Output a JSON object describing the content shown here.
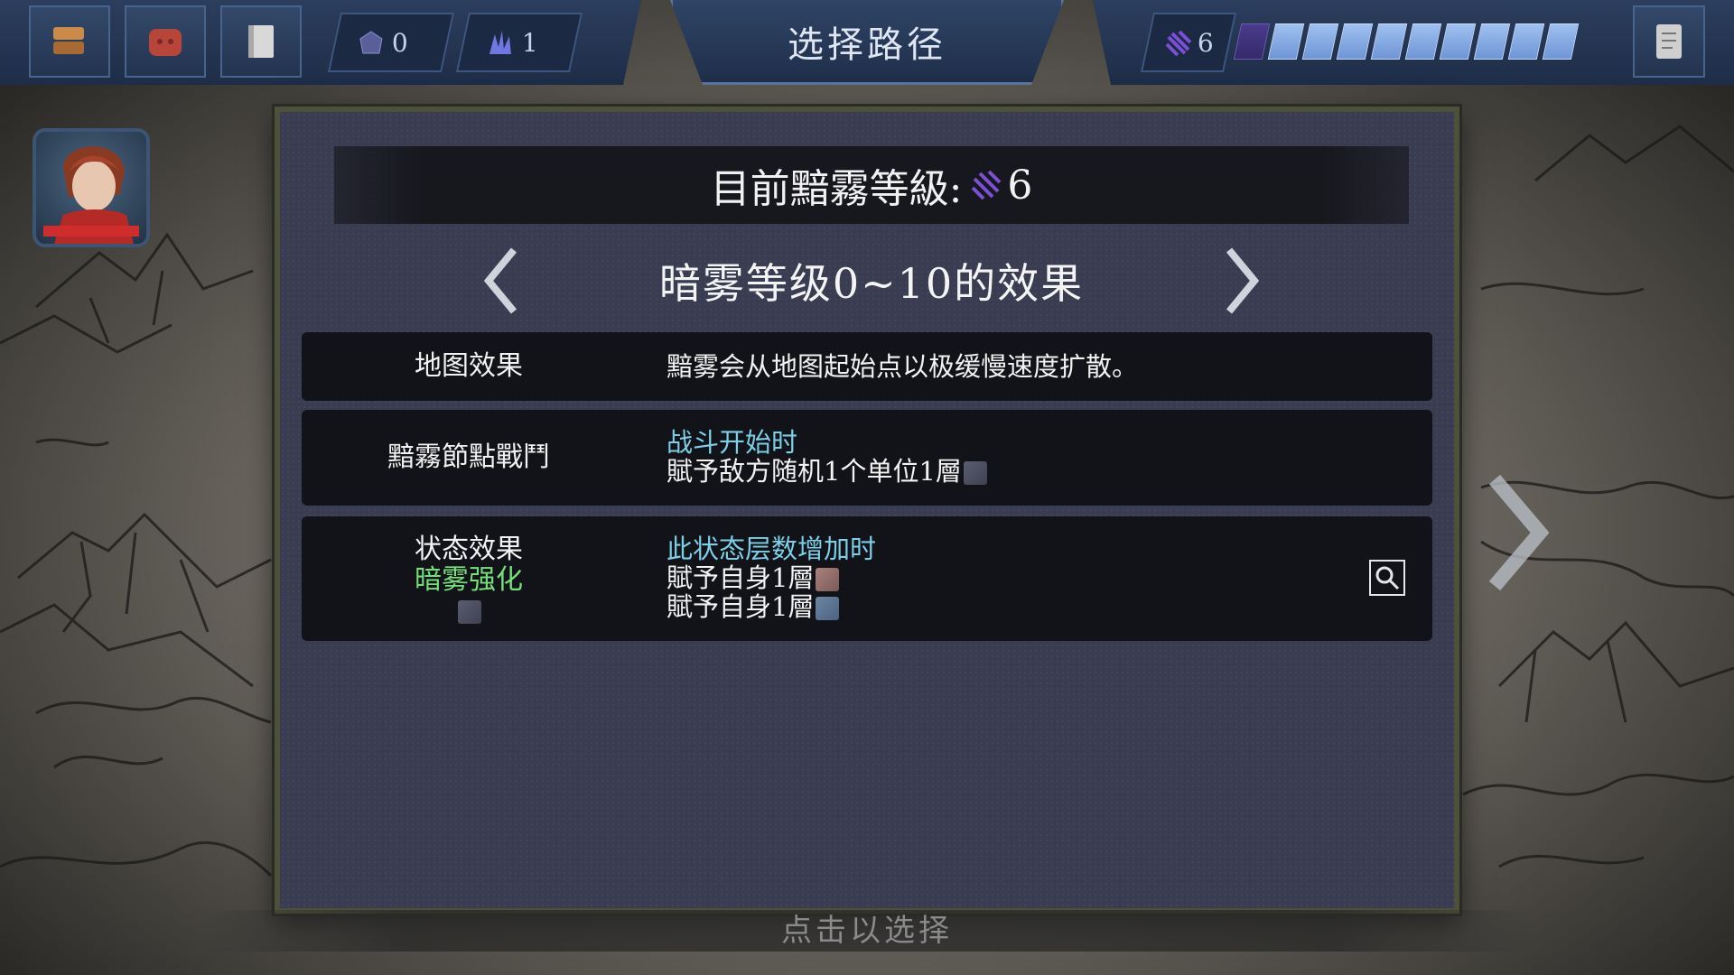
{
  "topbar": {
    "title": "选择路径",
    "resource_1_value": "0",
    "resource_2_value": "1",
    "fog_level_value": "6",
    "fog_gauge": {
      "filled": 9,
      "dark": 1
    }
  },
  "panel": {
    "header_label": "目前黯霧等級:",
    "header_level": "6",
    "range_title": "暗雾等级0~10的效果",
    "rows": [
      {
        "label": "地图效果",
        "desc": "黯雾会从地图起始点以极缓慢速度扩散。"
      },
      {
        "label": "黯霧節點戰鬥",
        "trigger": "战斗开始时",
        "desc": "賦予敌方随机1个单位1層"
      },
      {
        "label": "状态效果",
        "label_highlight": "暗雾强化",
        "trigger": "此状态层数增加时",
        "desc_1": "賦予自身1層",
        "desc_2": "賦予自身1層"
      }
    ]
  },
  "bottom_hint": "点击以选择",
  "colors": {
    "accent_teal": "#7ccfe6",
    "accent_green": "#74e07a",
    "fog_purple": "#7b4fd6"
  }
}
